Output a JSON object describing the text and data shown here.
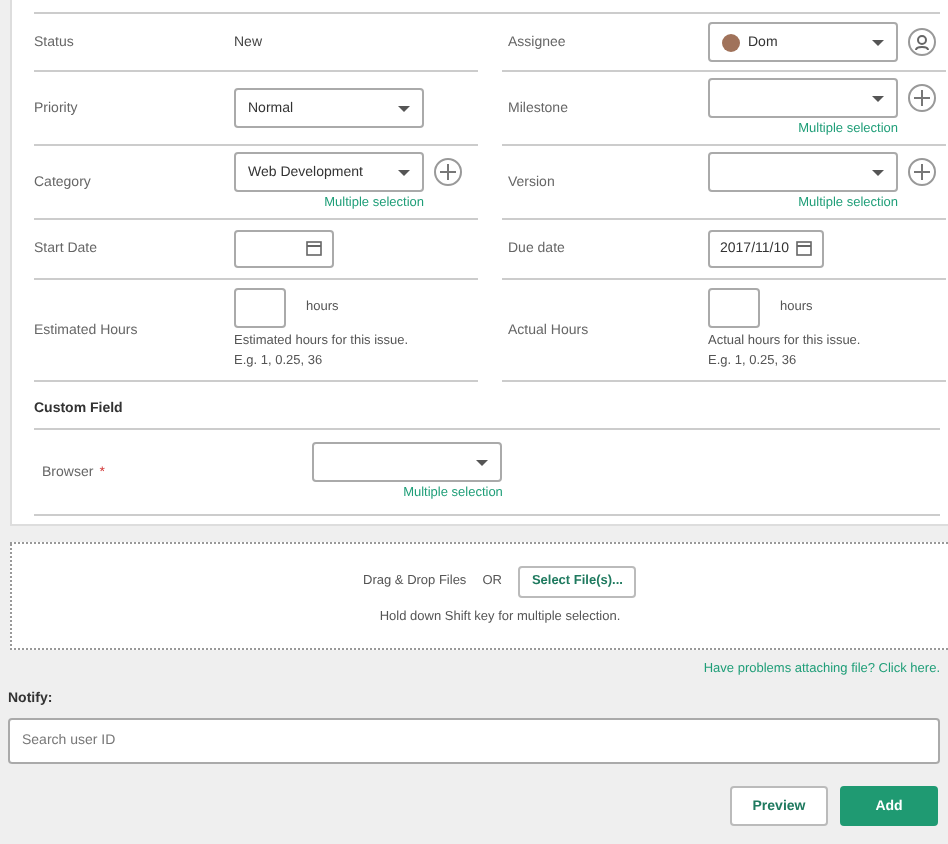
{
  "rows": [
    [
      {
        "label": "Status",
        "kind": "text",
        "value": "New"
      },
      {
        "label": "Assignee",
        "kind": "select",
        "value": "Dom",
        "avatar": true,
        "assign_button": true
      }
    ],
    [
      {
        "label": "Priority",
        "kind": "select",
        "value": "Normal"
      },
      {
        "label": "Milestone",
        "kind": "select",
        "add": true,
        "multiple": "Multiple selection"
      }
    ],
    [
      {
        "label": "Category",
        "kind": "select",
        "value": "Web Development",
        "add": true,
        "multiple": "Multiple selection"
      },
      {
        "label": "Version",
        "kind": "select",
        "add": true,
        "multiple": "Multiple selection"
      }
    ],
    [
      {
        "label": "Start Date",
        "kind": "date"
      },
      {
        "label": "Due date",
        "kind": "date",
        "value": "2017/11/10"
      }
    ],
    [
      {
        "label": "Estimated Hours",
        "kind": "hours",
        "unit": "hours",
        "hint": "Estimated hours for this issue.",
        "example": "E.g. 1, 0.25, 36"
      },
      {
        "label": "Actual Hours",
        "kind": "hours",
        "unit": "hours",
        "hint": "Actual hours for this issue.",
        "example": "E.g. 1, 0.25, 36"
      }
    ]
  ],
  "custom_field": {
    "title": "Custom Field",
    "label": "Browser",
    "required_mark": "*",
    "multiple": "Multiple selection"
  },
  "attach": {
    "drop_text": "Drag & Drop Files",
    "or": "OR",
    "button": "Select File(s)...",
    "hint": "Hold down Shift key for multiple selection.",
    "link": "Have problems attaching file? Click here."
  },
  "notify": {
    "label": "Notify:",
    "placeholder": "Search user ID"
  },
  "buttons": [
    {
      "label": "Preview",
      "kind": "secondary"
    },
    {
      "label": "Add",
      "kind": "primary"
    }
  ]
}
